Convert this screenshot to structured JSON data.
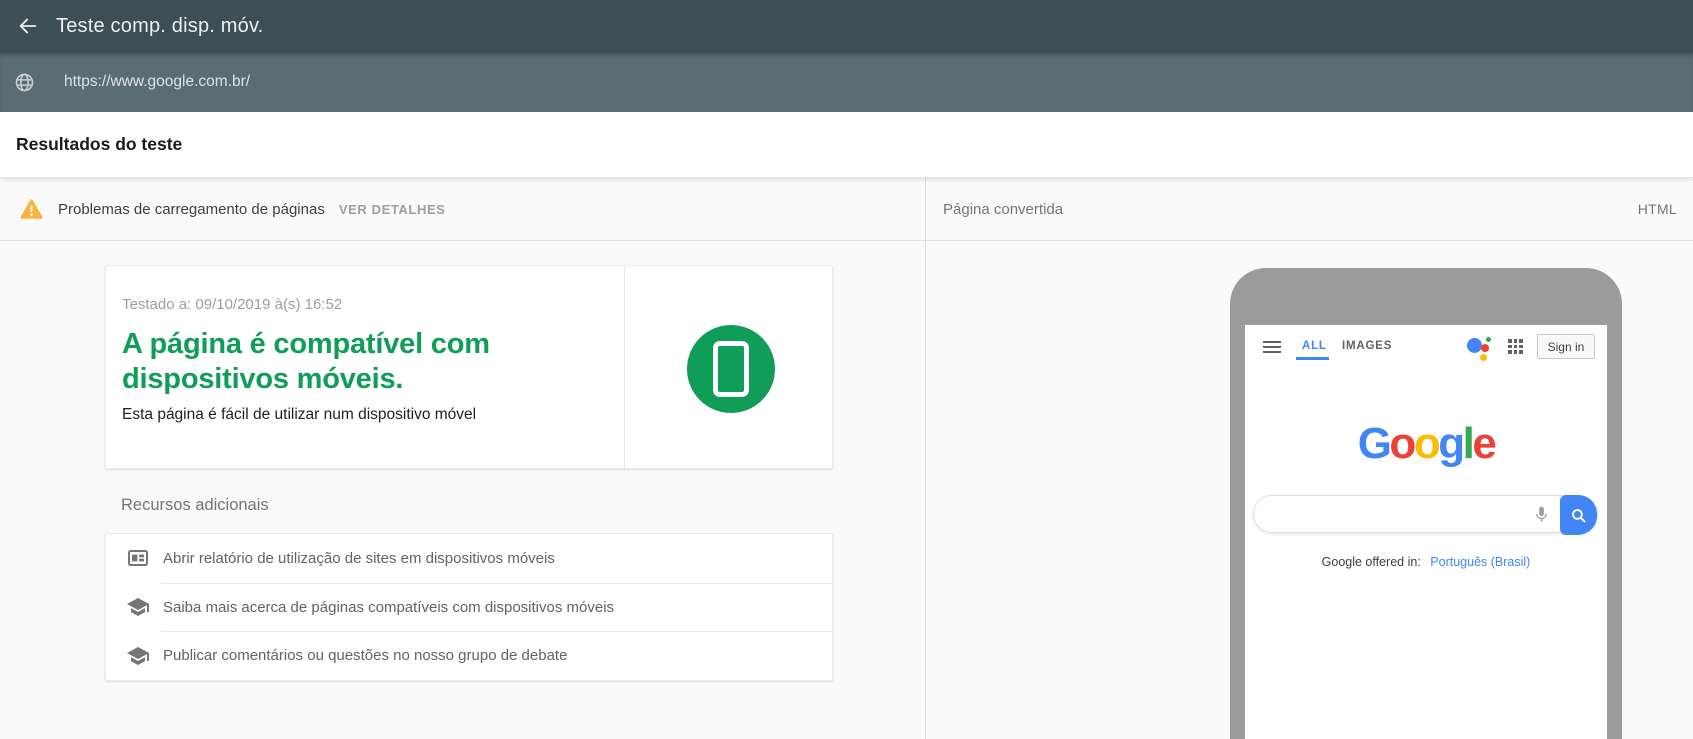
{
  "app": {
    "title": "Teste comp. disp. móv.",
    "url": "https://www.google.com.br/"
  },
  "results_header": "Resultados do teste",
  "left_panel": {
    "warning": {
      "icon": "warning-triangle-icon",
      "label": "Problemas de carregamento de páginas",
      "action": "VER DETALHES"
    },
    "result_card": {
      "tested_at": "Testado a: 09/10/2019 à(s) 16:52",
      "verdict": "A página é compatível com dispositivos móveis.",
      "description": "Esta página é fácil de utilizar num dispositivo móvel",
      "status_icon": "mobile-friendly-phone-icon"
    },
    "resources": {
      "title": "Recursos adicionais",
      "items": [
        {
          "icon": "web-report-icon",
          "label": "Abrir relatório de utilização de sites em dispositivos móveis"
        },
        {
          "icon": "school-icon",
          "label": "Saiba mais acerca de páginas compatíveis com dispositivos móveis"
        },
        {
          "icon": "school-icon",
          "label": "Publicar comentários ou questões no nosso grupo de debate"
        }
      ]
    }
  },
  "right_panel": {
    "title": "Página convertida",
    "action": "HTML",
    "phone": {
      "tabs": [
        {
          "label": "ALL",
          "active": true
        },
        {
          "label": "IMAGES",
          "active": false
        }
      ],
      "sign_in": "Sign in",
      "logo_letters": [
        {
          "ch": "G",
          "color": "#4285F4"
        },
        {
          "ch": "o",
          "color": "#EA4335"
        },
        {
          "ch": "o",
          "color": "#FBBC05"
        },
        {
          "ch": "g",
          "color": "#4285F4"
        },
        {
          "ch": "l",
          "color": "#34A853"
        },
        {
          "ch": "e",
          "color": "#EA4335"
        }
      ],
      "offered_in": {
        "prefix": "Google offered in:",
        "link": "Português (Brasil)"
      }
    }
  },
  "colors": {
    "header_bar": "#3e4e56",
    "url_bar": "#5b6c74",
    "accent_green": "#0f9d58",
    "warning_amber": "#f4b43e",
    "link_blue": "#4285f4",
    "phone_body_gray": "#9b9b9b",
    "panel_background": "#fafafa"
  }
}
